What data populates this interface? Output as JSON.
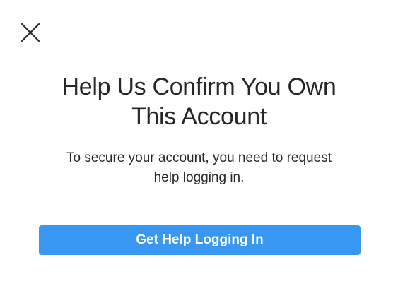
{
  "icons": {
    "close": "close-icon"
  },
  "colors": {
    "background": "#ffffff",
    "text": "#262626",
    "accent": "#3897f0",
    "button_text": "#ffffff"
  },
  "dialog": {
    "title_lines": [
      "Help Us Confirm You Own",
      "This Account"
    ],
    "description_lines": [
      "To secure your account, you need to request",
      "help logging in."
    ],
    "primary_button_label": "Get Help Logging In"
  }
}
